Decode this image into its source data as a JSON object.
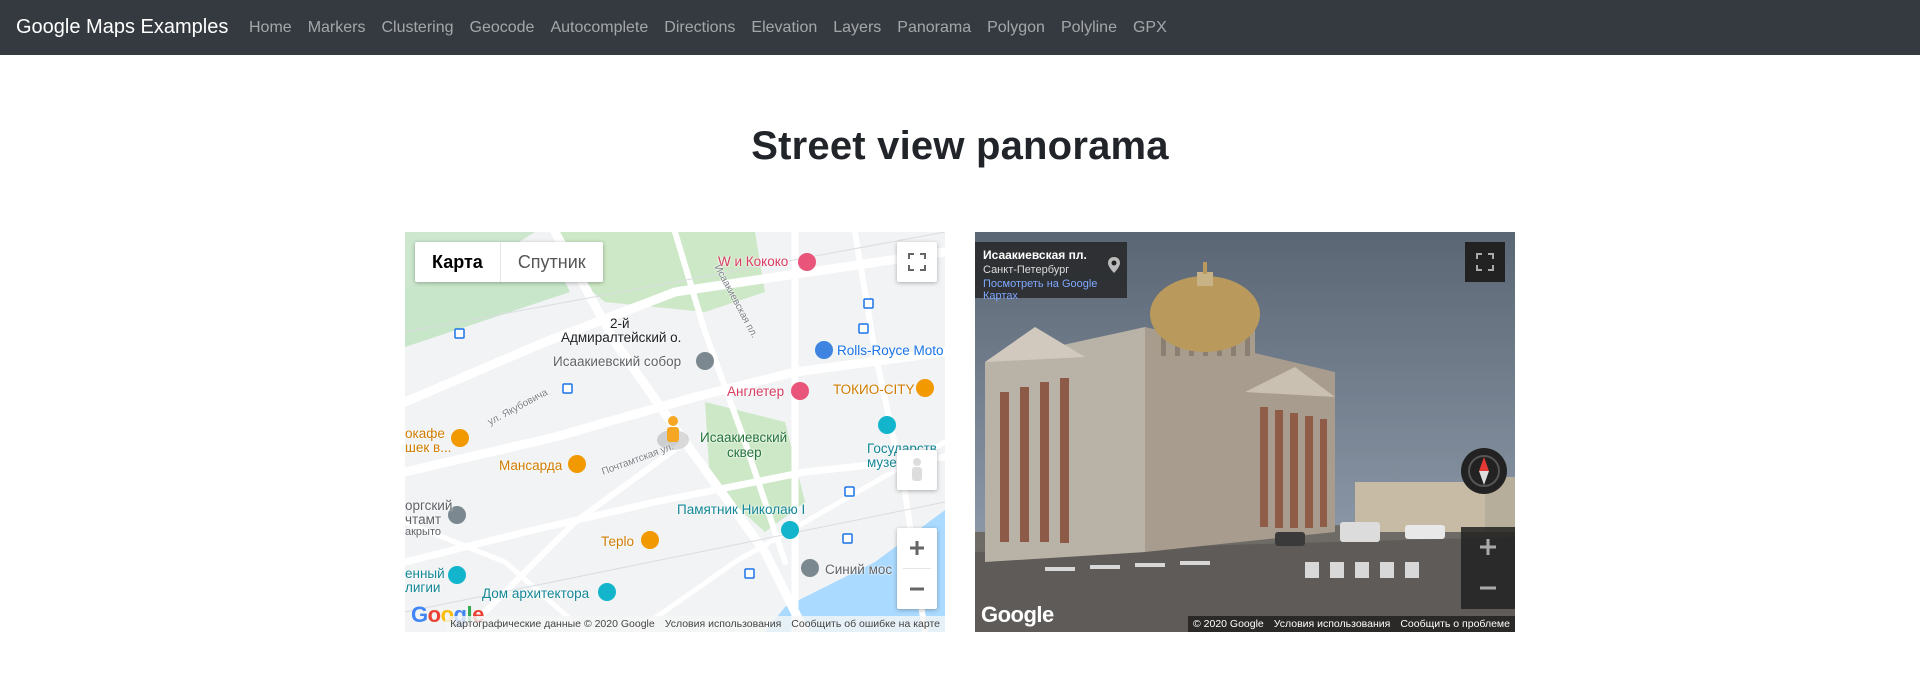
{
  "navbar": {
    "brand": "Google Maps Examples",
    "links": [
      "Home",
      "Markers",
      "Clustering",
      "Geocode",
      "Autocomplete",
      "Directions",
      "Elevation",
      "Layers",
      "Panorama",
      "Polygon",
      "Polyline",
      "GPX"
    ]
  },
  "page": {
    "title": "Street view panorama"
  },
  "map": {
    "map_type": {
      "map": "Карта",
      "satellite": "Спутник"
    },
    "labels": {
      "w_kokoko": "W и Кококо",
      "admiralteisky_1": "2-й",
      "admiralteisky_2": "Адмиралтейский о.",
      "isaac_cathedral": "Исаакиевский собор",
      "rolls_royce": "Rolls-Royce Moto",
      "angleter": "Англетер",
      "tokio_city": "ТОКИО-CITY",
      "isaac_square_1": "Исаакиевский",
      "isaac_square_2": "сквер",
      "mansarda": "Мансарда",
      "monument_nicholas": "Памятник Николаю I",
      "teplo": "Теplo",
      "blue_bridge": "Синий мос",
      "house_of_architect": "Дом архитектора",
      "state_museum_1": "Государств",
      "state_museum_2": "музей...ы",
      "cafe_1": "окафе",
      "cafe_2": "шек в...",
      "post_1": "оргский",
      "post_2": "чтамт",
      "post_3": "акрыто",
      "religion_1": "енный",
      "religion_2": "лигии",
      "street_yakubovicha": "ул. Якубовича",
      "street_pochtamtskaya": "Почтамтская ул.",
      "street_isaac": "Исаакиевская пл."
    },
    "attribution": [
      "Картографические данные © 2020 Google",
      "Условия использования",
      "Сообщить об ошибке на карте"
    ]
  },
  "panorama": {
    "location_title": "Исаакиевская пл.",
    "location_city": "Санкт-Петербург",
    "view_on_maps": "Посмотреть на Google Картах",
    "attribution": [
      "© 2020 Google",
      "Условия использования",
      "Сообщить о проблеме"
    ]
  },
  "icons": {
    "fullscreen": "fullscreen-icon",
    "zoom_in": "plus-icon",
    "zoom_out": "minus-icon",
    "pegman": "pegman-icon",
    "compass": "compass-icon",
    "pin": "location-pin-icon"
  }
}
